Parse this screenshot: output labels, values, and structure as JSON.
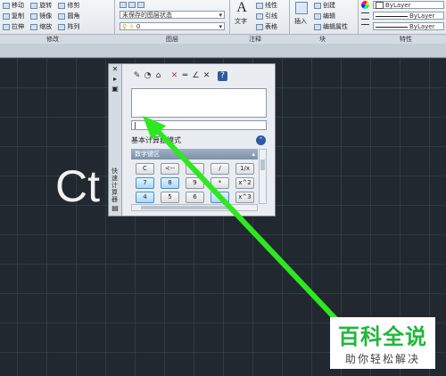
{
  "ribbon": {
    "modify": {
      "rows": [
        [
          "移动",
          "旋转",
          "修剪"
        ],
        [
          "复制",
          "镜像",
          "圆角"
        ],
        [
          "拉伸",
          "缩放",
          "阵列"
        ]
      ],
      "panel_label": "修改"
    },
    "layer": {
      "state_combo": "未保存的图层状态",
      "current_layer": "0",
      "panel_label": "图层"
    },
    "annotation": {
      "text_label": "文字",
      "linear": "线性",
      "leader": "引线",
      "table": "表格",
      "panel_label": "注释"
    },
    "block": {
      "insert": "插入",
      "create": "创建",
      "edit": "编辑",
      "edit_attr": "编辑属性",
      "panel_label": "块"
    },
    "properties": {
      "bylayer_1": "ByLayer",
      "bylayer_2": "ByLayer",
      "bylayer_3": "ByLayer",
      "panel_label": "特性"
    }
  },
  "canvas": {
    "big_text": "Ct"
  },
  "calculator": {
    "side_title": "快速计算器",
    "side_close": "✕",
    "input_value": "|",
    "mode_label": "基本计算器模式",
    "keypad_title": "数字键区",
    "keys": [
      {
        "label": "C",
        "style": "normal"
      },
      {
        "label": "<--",
        "style": "normal"
      },
      {
        "label": "",
        "style": "normal"
      },
      {
        "label": "/",
        "style": "normal"
      },
      {
        "label": "1/x",
        "style": "normal"
      },
      {
        "label": "7",
        "style": "blue"
      },
      {
        "label": "8",
        "style": "blue"
      },
      {
        "label": "9",
        "style": "normal"
      },
      {
        "label": "*",
        "style": "normal"
      },
      {
        "label": "x^2",
        "style": "normal"
      },
      {
        "label": "4",
        "style": "blue"
      },
      {
        "label": "5",
        "style": "normal"
      },
      {
        "label": "6",
        "style": "normal"
      },
      {
        "label": "+",
        "style": "blue"
      },
      {
        "label": "x^3",
        "style": "normal"
      }
    ]
  },
  "overlay": {
    "arrow_color": "#2ee81f"
  },
  "watermark": {
    "title": "百科全说",
    "subtitle": "助你轻松解决"
  }
}
